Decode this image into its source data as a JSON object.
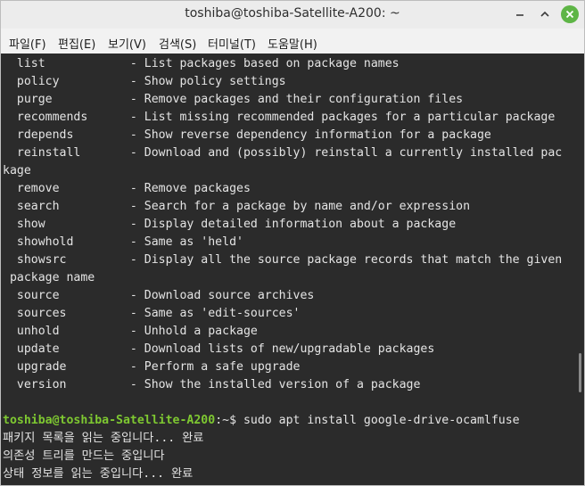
{
  "window": {
    "title": "toshiba@toshiba-Satellite-A200: ~"
  },
  "menubar": {
    "file": "파일(F)",
    "edit": "편집(E)",
    "view": "보기(V)",
    "search": "검색(S)",
    "terminal": "터미널(T)",
    "help": "도움말(H)"
  },
  "terminal": {
    "lines": [
      "  list            - List packages based on package names",
      "  policy          - Show policy settings",
      "  purge           - Remove packages and their configuration files",
      "  recommends      - List missing recommended packages for a particular package",
      "  rdepends        - Show reverse dependency information for a package",
      "  reinstall       - Download and (possibly) reinstall a currently installed pac",
      "kage",
      "  remove          - Remove packages",
      "  search          - Search for a package by name and/or expression",
      "  show            - Display detailed information about a package",
      "  showhold        - Same as 'held'",
      "  showsrc         - Display all the source package records that match the given",
      " package name",
      "  source          - Download source archives",
      "  sources         - Same as 'edit-sources'",
      "  unhold          - Unhold a package",
      "  update          - Download lists of new/upgradable packages",
      "  upgrade         - Perform a safe upgrade",
      "  version         - Show the installed version of a package",
      ""
    ],
    "prompt_user": "toshiba@toshiba-Satellite-A200",
    "prompt_rest": ":~$ sudo apt install google-drive-ocamlfuse",
    "output": [
      "패키지 목록을 읽는 중입니다... 완료",
      "의존성 트리를 만드는 중입니다",
      "상태 정보를 읽는 중입니다... 완료"
    ]
  },
  "colors": {
    "terminal_bg": "#2b2b2b",
    "prompt_green": "#7ec831",
    "close_green": "#5eb546"
  },
  "icons": {
    "minimize": "minimize-icon",
    "maximize": "maximize-icon",
    "close": "close-icon"
  }
}
